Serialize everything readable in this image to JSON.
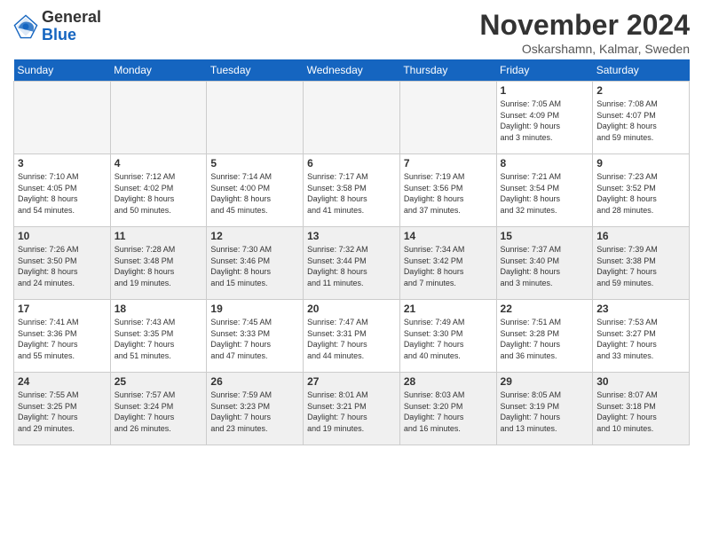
{
  "header": {
    "logo_general": "General",
    "logo_blue": "Blue",
    "month_title": "November 2024",
    "location": "Oskarshamn, Kalmar, Sweden"
  },
  "days_of_week": [
    "Sunday",
    "Monday",
    "Tuesday",
    "Wednesday",
    "Thursday",
    "Friday",
    "Saturday"
  ],
  "weeks": [
    [
      {
        "day": "",
        "info": "",
        "empty": true
      },
      {
        "day": "",
        "info": "",
        "empty": true
      },
      {
        "day": "",
        "info": "",
        "empty": true
      },
      {
        "day": "",
        "info": "",
        "empty": true
      },
      {
        "day": "",
        "info": "",
        "empty": true
      },
      {
        "day": "1",
        "info": "Sunrise: 7:05 AM\nSunset: 4:09 PM\nDaylight: 9 hours\nand 3 minutes."
      },
      {
        "day": "2",
        "info": "Sunrise: 7:08 AM\nSunset: 4:07 PM\nDaylight: 8 hours\nand 59 minutes."
      }
    ],
    [
      {
        "day": "3",
        "info": "Sunrise: 7:10 AM\nSunset: 4:05 PM\nDaylight: 8 hours\nand 54 minutes."
      },
      {
        "day": "4",
        "info": "Sunrise: 7:12 AM\nSunset: 4:02 PM\nDaylight: 8 hours\nand 50 minutes."
      },
      {
        "day": "5",
        "info": "Sunrise: 7:14 AM\nSunset: 4:00 PM\nDaylight: 8 hours\nand 45 minutes."
      },
      {
        "day": "6",
        "info": "Sunrise: 7:17 AM\nSunset: 3:58 PM\nDaylight: 8 hours\nand 41 minutes."
      },
      {
        "day": "7",
        "info": "Sunrise: 7:19 AM\nSunset: 3:56 PM\nDaylight: 8 hours\nand 37 minutes."
      },
      {
        "day": "8",
        "info": "Sunrise: 7:21 AM\nSunset: 3:54 PM\nDaylight: 8 hours\nand 32 minutes."
      },
      {
        "day": "9",
        "info": "Sunrise: 7:23 AM\nSunset: 3:52 PM\nDaylight: 8 hours\nand 28 minutes."
      }
    ],
    [
      {
        "day": "10",
        "info": "Sunrise: 7:26 AM\nSunset: 3:50 PM\nDaylight: 8 hours\nand 24 minutes."
      },
      {
        "day": "11",
        "info": "Sunrise: 7:28 AM\nSunset: 3:48 PM\nDaylight: 8 hours\nand 19 minutes."
      },
      {
        "day": "12",
        "info": "Sunrise: 7:30 AM\nSunset: 3:46 PM\nDaylight: 8 hours\nand 15 minutes."
      },
      {
        "day": "13",
        "info": "Sunrise: 7:32 AM\nSunset: 3:44 PM\nDaylight: 8 hours\nand 11 minutes."
      },
      {
        "day": "14",
        "info": "Sunrise: 7:34 AM\nSunset: 3:42 PM\nDaylight: 8 hours\nand 7 minutes."
      },
      {
        "day": "15",
        "info": "Sunrise: 7:37 AM\nSunset: 3:40 PM\nDaylight: 8 hours\nand 3 minutes."
      },
      {
        "day": "16",
        "info": "Sunrise: 7:39 AM\nSunset: 3:38 PM\nDaylight: 7 hours\nand 59 minutes."
      }
    ],
    [
      {
        "day": "17",
        "info": "Sunrise: 7:41 AM\nSunset: 3:36 PM\nDaylight: 7 hours\nand 55 minutes."
      },
      {
        "day": "18",
        "info": "Sunrise: 7:43 AM\nSunset: 3:35 PM\nDaylight: 7 hours\nand 51 minutes."
      },
      {
        "day": "19",
        "info": "Sunrise: 7:45 AM\nSunset: 3:33 PM\nDaylight: 7 hours\nand 47 minutes."
      },
      {
        "day": "20",
        "info": "Sunrise: 7:47 AM\nSunset: 3:31 PM\nDaylight: 7 hours\nand 44 minutes."
      },
      {
        "day": "21",
        "info": "Sunrise: 7:49 AM\nSunset: 3:30 PM\nDaylight: 7 hours\nand 40 minutes."
      },
      {
        "day": "22",
        "info": "Sunrise: 7:51 AM\nSunset: 3:28 PM\nDaylight: 7 hours\nand 36 minutes."
      },
      {
        "day": "23",
        "info": "Sunrise: 7:53 AM\nSunset: 3:27 PM\nDaylight: 7 hours\nand 33 minutes."
      }
    ],
    [
      {
        "day": "24",
        "info": "Sunrise: 7:55 AM\nSunset: 3:25 PM\nDaylight: 7 hours\nand 29 minutes."
      },
      {
        "day": "25",
        "info": "Sunrise: 7:57 AM\nSunset: 3:24 PM\nDaylight: 7 hours\nand 26 minutes."
      },
      {
        "day": "26",
        "info": "Sunrise: 7:59 AM\nSunset: 3:23 PM\nDaylight: 7 hours\nand 23 minutes."
      },
      {
        "day": "27",
        "info": "Sunrise: 8:01 AM\nSunset: 3:21 PM\nDaylight: 7 hours\nand 19 minutes."
      },
      {
        "day": "28",
        "info": "Sunrise: 8:03 AM\nSunset: 3:20 PM\nDaylight: 7 hours\nand 16 minutes."
      },
      {
        "day": "29",
        "info": "Sunrise: 8:05 AM\nSunset: 3:19 PM\nDaylight: 7 hours\nand 13 minutes."
      },
      {
        "day": "30",
        "info": "Sunrise: 8:07 AM\nSunset: 3:18 PM\nDaylight: 7 hours\nand 10 minutes."
      }
    ]
  ]
}
